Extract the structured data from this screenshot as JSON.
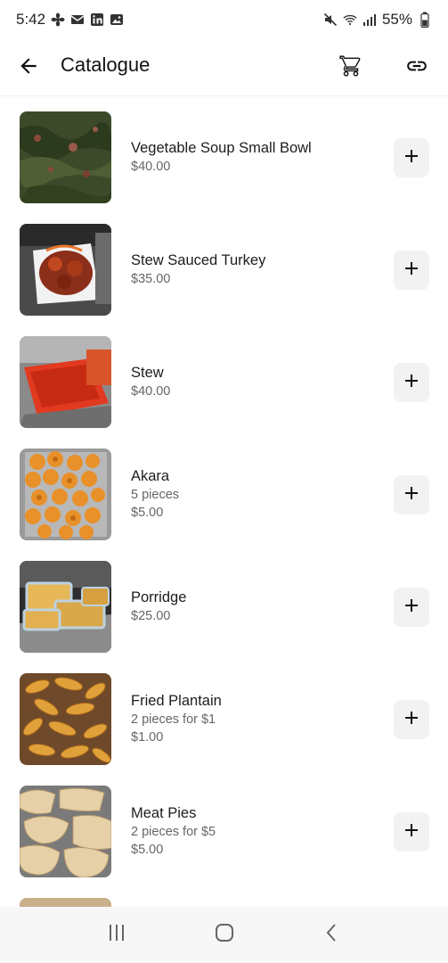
{
  "status": {
    "time": "5:42",
    "battery": "55%",
    "left_icons": [
      "fan-icon",
      "mail-icon",
      "linkedin-icon",
      "gallery-icon"
    ],
    "right_icons": [
      "mute-icon",
      "wifi-icon",
      "signal-icon",
      "battery-icon"
    ]
  },
  "header": {
    "title": "Catalogue",
    "icons": [
      "back-arrow-icon",
      "cart-icon",
      "link-icon"
    ]
  },
  "items": [
    {
      "name": "Vegetable Soup Small Bowl",
      "desc": "",
      "price": "$40.00"
    },
    {
      "name": "Stew Sauced Turkey",
      "desc": "",
      "price": "$35.00"
    },
    {
      "name": "Stew",
      "desc": "",
      "price": "$40.00"
    },
    {
      "name": "Akara",
      "desc": "5 pieces",
      "price": "$5.00"
    },
    {
      "name": "Porridge",
      "desc": "",
      "price": "$25.00"
    },
    {
      "name": "Fried Plantain",
      "desc": "2 pieces for $1",
      "price": "$1.00"
    },
    {
      "name": "Meat Pies",
      "desc": "2 pieces for $5",
      "price": "$5.00"
    }
  ],
  "nav": {
    "icons": [
      "recent-apps-icon",
      "home-icon",
      "back-icon"
    ]
  },
  "colors": {
    "accent": "#1c1c1c",
    "button_bg": "#f2f2f2",
    "secondary_text": "#666666"
  }
}
